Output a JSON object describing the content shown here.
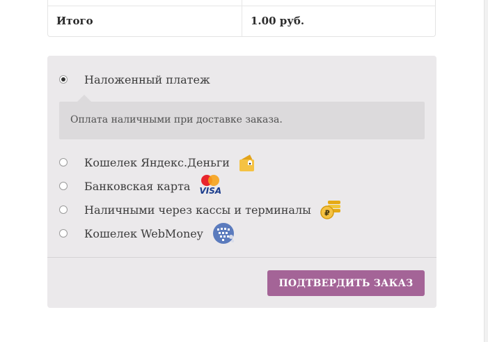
{
  "totals": {
    "label": "Итого",
    "value": "1.00 руб."
  },
  "payment": {
    "methods": [
      {
        "label": "Наложенный платеж",
        "selected": true,
        "icon": null
      },
      {
        "label": "Кошелек Яндекс.Деньги",
        "selected": false,
        "icon": "yandex-money-wallet-icon"
      },
      {
        "label": "Банковская карта",
        "selected": false,
        "icon": "mastercard-visa-icon"
      },
      {
        "label": "Наличными через кассы и терминалы",
        "selected": false,
        "icon": "ruble-coins-icon"
      },
      {
        "label": "Кошелек WebMoney",
        "selected": false,
        "icon": "webmoney-globe-icon"
      }
    ],
    "selected_description": "Оплата наличными при доставке заказа.",
    "card_logo_text": "VISA",
    "place_order_label": "ПОДТВЕРДИТЬ ЗАКАЗ"
  },
  "colors": {
    "button": "#a46497",
    "panel": "#ebe9eb",
    "description_box": "#dcdadc"
  }
}
